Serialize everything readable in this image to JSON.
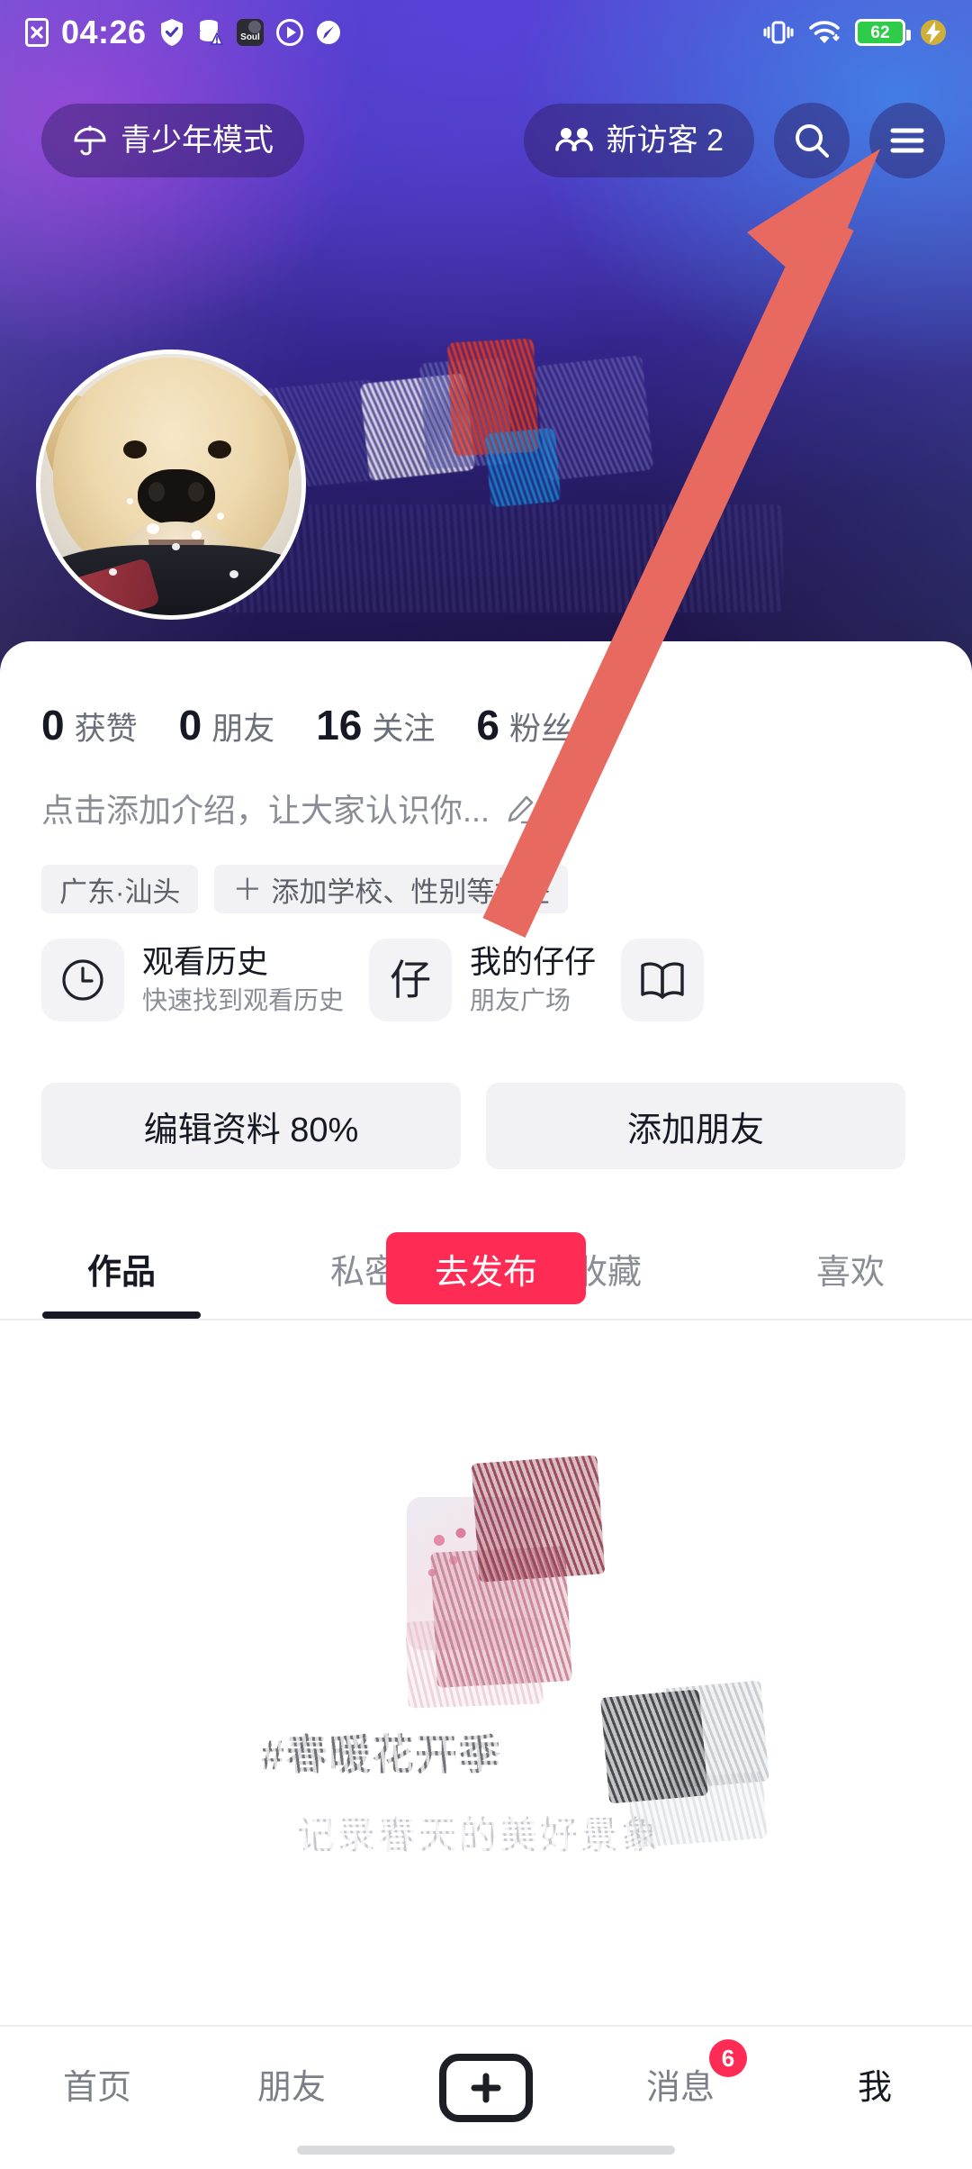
{
  "status_bar": {
    "time": "04:26",
    "battery_percent": "62",
    "left_icons": [
      "no-sim-icon",
      "shield-check-icon",
      "data-off-icon",
      "soul-app-icon",
      "play-circle-icon",
      "compass-icon"
    ],
    "right_icons": [
      "vibrate-icon",
      "wifi-icon",
      "battery-icon",
      "fast-charge-icon"
    ]
  },
  "top_bar": {
    "teen_mode_label": "青少年模式",
    "teen_mode_icon": "umbrella-icon",
    "visitor_label": "新访客 2",
    "visitor_icon": "people-icon",
    "search_icon": "search-icon",
    "menu_icon": "hamburger-menu-icon"
  },
  "profile": {
    "avatar": "golden-retriever-puppy-photo",
    "stats": [
      {
        "num": "0",
        "label": "获赞"
      },
      {
        "num": "0",
        "label": "朋友"
      },
      {
        "num": "16",
        "label": "关注"
      },
      {
        "num": "6",
        "label": "粉丝"
      }
    ],
    "bio_placeholder": "点击添加介绍，让大家认识你...",
    "bio_edit_icon": "pencil-icon",
    "tags": [
      {
        "label": "广东·汕头",
        "has_plus": false
      },
      {
        "label": "添加学校、性别等标签",
        "has_plus": true
      }
    ]
  },
  "entry_cards": [
    {
      "icon": "clock-icon",
      "glyph": "",
      "title": "观看历史",
      "sub": "快速找到观看历史"
    },
    {
      "icon": "zai-character-icon",
      "glyph": "仔",
      "title": "我的仔仔",
      "sub": "朋友广场"
    },
    {
      "icon": "book-icon",
      "glyph": "",
      "title": "",
      "sub": ""
    }
  ],
  "actions": [
    {
      "label": "编辑资料 80%"
    },
    {
      "label": "添加朋友"
    }
  ],
  "tabs": [
    {
      "label": "作品",
      "active": true
    },
    {
      "label": "私密",
      "active": false
    },
    {
      "label": "收藏",
      "active": false
    },
    {
      "label": "喜欢",
      "active": false
    }
  ],
  "empty_state": {
    "banner_hashtag": "#春暖花开季",
    "banner_subtitle": "记录春天的美好景象",
    "publish_label": "去发布",
    "publish_color": "#fe2c55"
  },
  "bottom_nav": {
    "items": [
      {
        "label": "首页",
        "active": false,
        "badge": ""
      },
      {
        "label": "朋友",
        "active": false,
        "badge": ""
      },
      {
        "label": "",
        "active": false,
        "badge": "",
        "icon": "plus-icon"
      },
      {
        "label": "消息",
        "active": false,
        "badge": "6"
      },
      {
        "label": "我",
        "active": true,
        "badge": ""
      }
    ]
  },
  "annotation": {
    "arrow_color": "#e8695f",
    "arrow_target": "hamburger-menu-icon"
  },
  "colors": {
    "accent_red": "#fe2c55",
    "cover_purple": "#4a35b6",
    "cover_deep": "#1d1442",
    "text_primary": "#161823",
    "text_secondary": "#8a8d96",
    "chip_bg": "#f2f2f4"
  }
}
